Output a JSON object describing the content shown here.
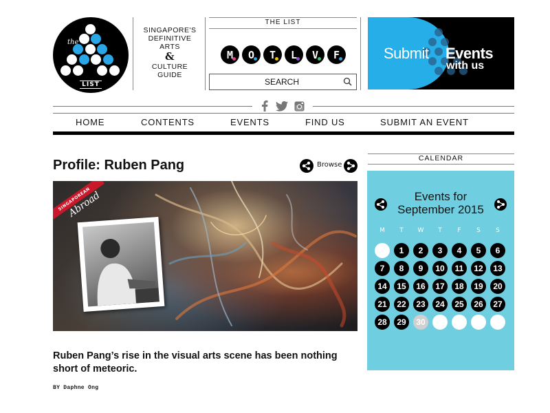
{
  "logo": {
    "the": "the",
    "list": "LIST"
  },
  "tagline": {
    "line1": "Singapore's",
    "line2": "Definitive",
    "line3": "Arts",
    "amp": "&",
    "line4": "Culture",
    "line5": "Guide"
  },
  "the_list": {
    "title": "THE LIST",
    "motlve_letters": [
      "M",
      "O",
      "T",
      "L",
      "V",
      "F"
    ],
    "search_placeholder": "SEARCH"
  },
  "submit_banner": {
    "word1": "Submit",
    "word2": "Events",
    "word3": "with us",
    "accent": "#25aee7"
  },
  "social": [
    "facebook-icon",
    "twitter-icon",
    "instagram-icon"
  ],
  "nav": {
    "home": "HOME",
    "contents": "CONTENTS",
    "events": "EVENTS",
    "find_us": "FIND US",
    "submit_event": "SUBMIT AN EVENT"
  },
  "article": {
    "title": "Profile: Ruben Pang",
    "browse": "Browse",
    "ribbon": "SINGAPOREAN",
    "ribbon_script": "Abroad",
    "lead": "Ruben Pang’s rise in the visual arts scene has been nothing short of meteoric.",
    "byline": "BY Daphne Ong"
  },
  "calendar": {
    "heading": "CALENDAR",
    "title_line1": "Events for",
    "title_line2": "September 2015",
    "weekdays": [
      "M",
      "T",
      "W",
      "T",
      "F",
      "S",
      "S"
    ],
    "days": [
      "1",
      "2",
      "3",
      "4",
      "5",
      "6",
      "7",
      "8",
      "9",
      "10",
      "11",
      "12",
      "13",
      "14",
      "15",
      "16",
      "17",
      "18",
      "19",
      "20",
      "21",
      "22",
      "23",
      "24",
      "25",
      "26",
      "27",
      "28",
      "29",
      "30"
    ],
    "past_day": "30",
    "bg_color": "#6fcfe0"
  }
}
